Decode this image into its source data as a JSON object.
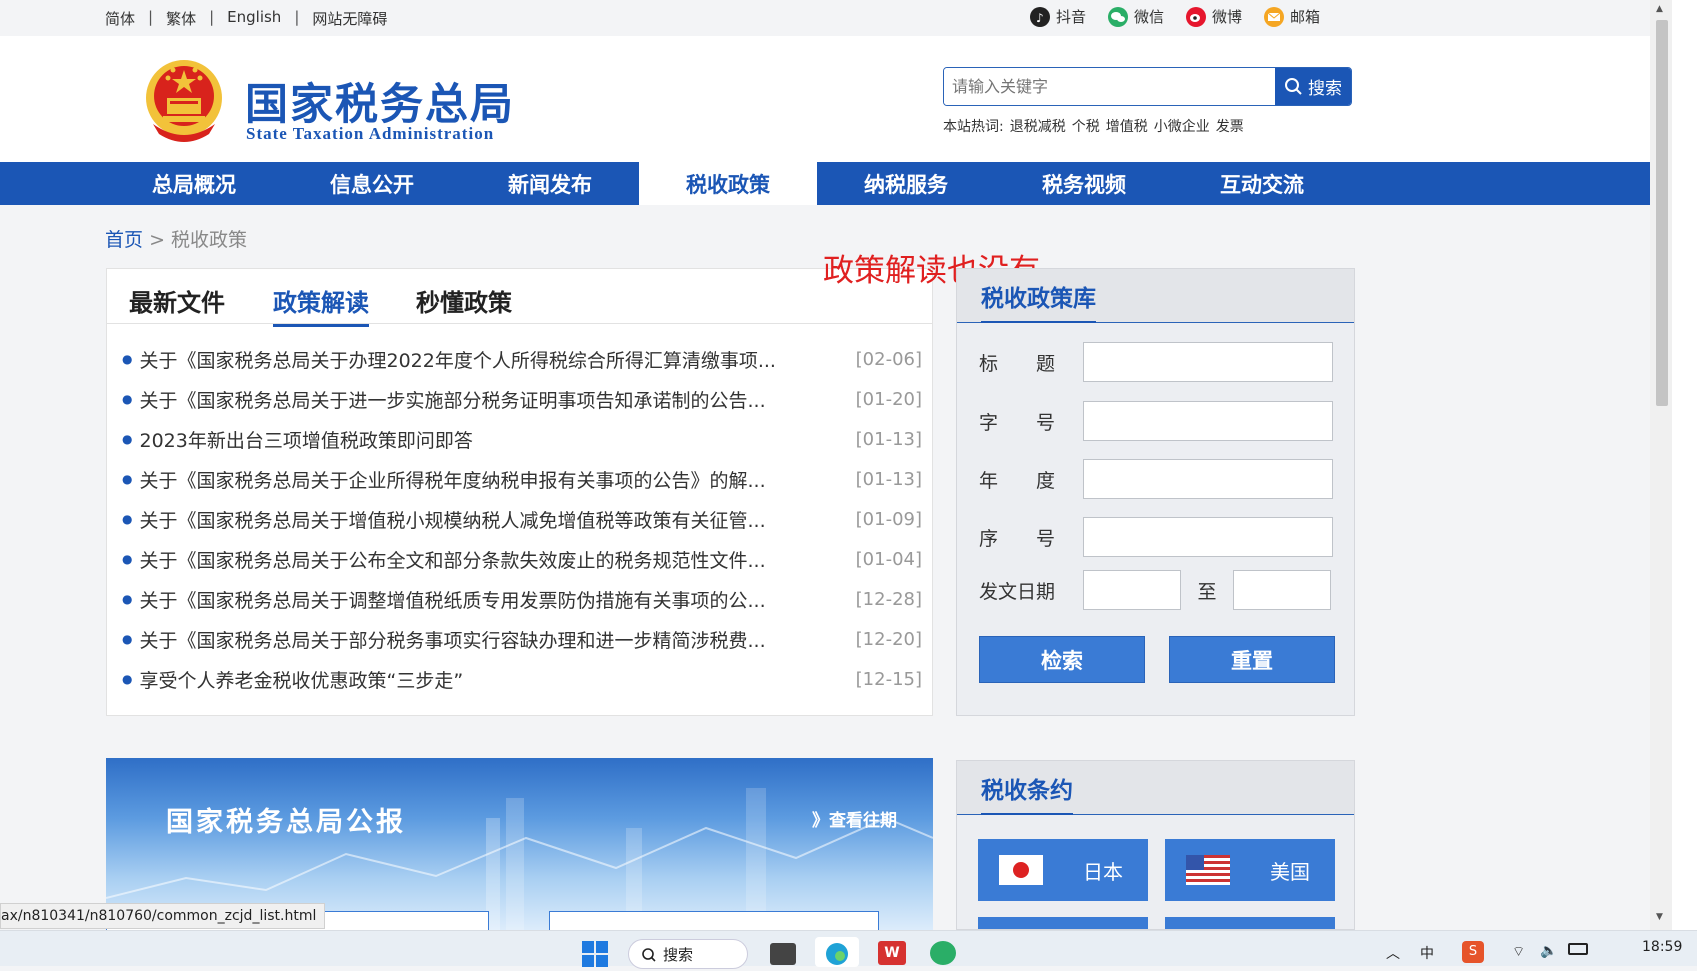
{
  "topbar": {
    "langs": [
      "简体",
      "繁体",
      "English",
      "网站无障碍"
    ],
    "social": [
      {
        "label": "抖音",
        "icon": "douyin-icon",
        "color": "#222222"
      },
      {
        "label": "微信",
        "icon": "wechat-icon",
        "color": "#2aae67"
      },
      {
        "label": "微博",
        "icon": "weibo-icon",
        "color": "#e6162d"
      },
      {
        "label": "邮箱",
        "icon": "mail-icon",
        "color": "#f5a623"
      }
    ]
  },
  "header": {
    "title_cn": "国家税务总局",
    "title_en": "State Taxation Administration",
    "search_placeholder": "请输入关键字",
    "search_button": "搜索",
    "hot_label": "本站热词:",
    "hot_words": [
      "退税减税",
      "个税",
      "增值税",
      "小微企业",
      "发票"
    ]
  },
  "nav": {
    "items": [
      "总局概况",
      "信息公开",
      "新闻发布",
      "税收政策",
      "纳税服务",
      "税务视频",
      "互动交流"
    ],
    "active_index": 3
  },
  "breadcrumb": {
    "home": "首页",
    "sep": ">",
    "current": "税收政策"
  },
  "annotation": "政策解读也没有",
  "policy_card": {
    "tabs": [
      "最新文件",
      "政策解读",
      "秒懂政策"
    ],
    "active_tab": 1,
    "items": [
      {
        "title": "关于《国家税务总局关于办理2022年度个人所得税综合所得汇算清缴事项...",
        "date": "[02-06]"
      },
      {
        "title": "关于《国家税务总局关于进一步实施部分税务证明事项告知承诺制的公告...",
        "date": "[01-20]"
      },
      {
        "title": "2023年新出台三项增值税政策即问即答",
        "date": "[01-13]"
      },
      {
        "title": "关于《国家税务总局关于企业所得税年度纳税申报有关事项的公告》的解...",
        "date": "[01-13]"
      },
      {
        "title": "关于《国家税务总局关于增值税小规模纳税人减免增值税等政策有关征管...",
        "date": "[01-09]"
      },
      {
        "title": "关于《国家税务总局关于公布全文和部分条款失效废止的税务规范性文件...",
        "date": "[01-04]"
      },
      {
        "title": "关于《国家税务总局关于调整增值税纸质专用发票防伪措施有关事项的公...",
        "date": "[12-28]"
      },
      {
        "title": "关于《国家税务总局关于部分税务事项实行容缺办理和进一步精简涉税费...",
        "date": "[12-20]"
      },
      {
        "title": "享受个人养老金税收优惠政策“三步走”",
        "date": "[12-15]"
      }
    ]
  },
  "policy_lib": {
    "title": "税收政策库",
    "fields": [
      "标　　题",
      "字　　号",
      "年　　度",
      "序　　号"
    ],
    "date_label": "发文日期",
    "date_to": "至",
    "search_button": "检索",
    "reset_button": "重置"
  },
  "bulletin": {
    "title": "国家税务总局公报",
    "more": "》查看往期"
  },
  "treaty": {
    "title": "税收条约",
    "countries": [
      "日本",
      "美国"
    ]
  },
  "status_url": "ax/n810341/n810760/common_zcjd_list.html",
  "taskbar": {
    "search": "搜索",
    "time": "18:59"
  }
}
